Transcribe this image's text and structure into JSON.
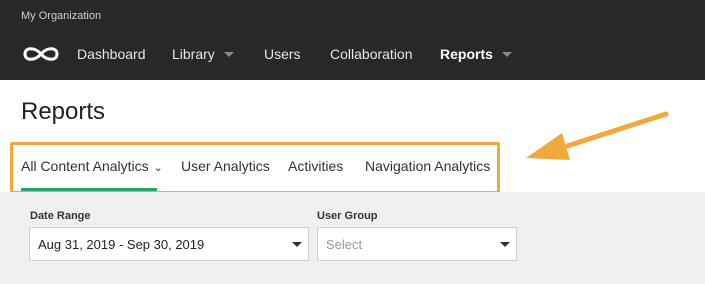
{
  "org_name": "My Organization",
  "nav": {
    "items": [
      {
        "label": "Dashboard",
        "has_caret": false,
        "active": false
      },
      {
        "label": "Library",
        "has_caret": true,
        "active": false
      },
      {
        "label": "Users",
        "has_caret": false,
        "active": false
      },
      {
        "label": "Collaboration",
        "has_caret": false,
        "active": false
      },
      {
        "label": "Reports",
        "has_caret": true,
        "active": true
      }
    ]
  },
  "page": {
    "title": "Reports"
  },
  "tabs": [
    {
      "label": "All Content Analytics",
      "active": true,
      "dropdown": true
    },
    {
      "label": "User Analytics",
      "active": false
    },
    {
      "label": "Activities",
      "active": false
    },
    {
      "label": "Navigation Analytics",
      "active": false
    }
  ],
  "filters": {
    "date_range": {
      "label": "Date Range",
      "value": "Aug 31, 2019 - Sep 30, 2019"
    },
    "user_group": {
      "label": "User Group",
      "placeholder": "Select"
    }
  },
  "colors": {
    "topbar": "#282828",
    "accent_underline": "#2aa36a",
    "annotation": "#f2a93b"
  }
}
